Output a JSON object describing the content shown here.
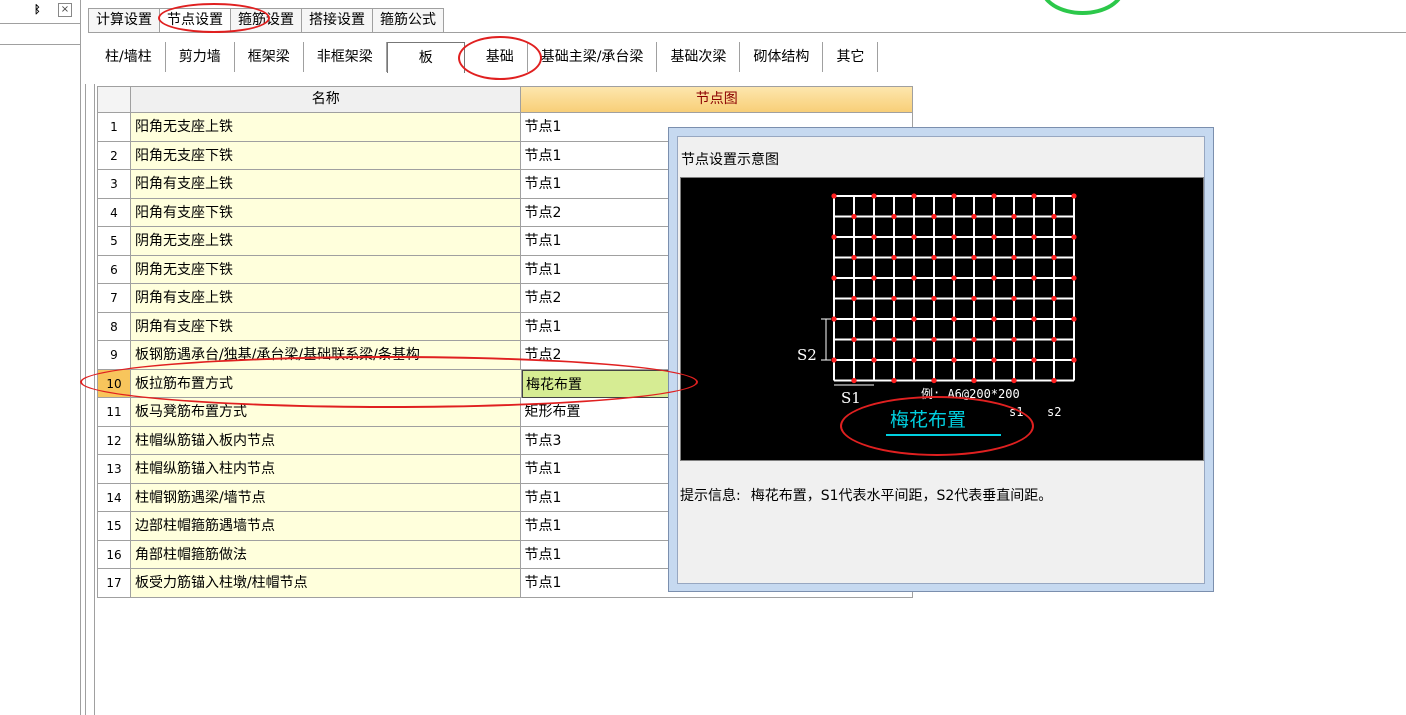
{
  "left_panel": {
    "pin": "📌",
    "close": "×"
  },
  "main_tabs": [
    "计算设置",
    "节点设置",
    "箍筋设置",
    "搭接设置",
    "箍筋公式"
  ],
  "main_tab_active": 1,
  "sub_tabs": [
    "柱/墙柱",
    "剪力墙",
    "框架梁",
    "非框架梁",
    "板",
    "基础",
    "基础主梁/承台梁",
    "基础次梁",
    "砌体结构",
    "其它"
  ],
  "sub_tab_active": 4,
  "grid": {
    "headers": {
      "name": "名称",
      "node": "节点图"
    },
    "rows": [
      {
        "num": "1",
        "name": "阳角无支座上铁",
        "node": "节点1"
      },
      {
        "num": "2",
        "name": "阳角无支座下铁",
        "node": "节点1"
      },
      {
        "num": "3",
        "name": "阳角有支座上铁",
        "node": "节点1"
      },
      {
        "num": "4",
        "name": "阳角有支座下铁",
        "node": "节点2"
      },
      {
        "num": "5",
        "name": "阴角无支座上铁",
        "node": "节点1"
      },
      {
        "num": "6",
        "name": "阴角无支座下铁",
        "node": "节点1"
      },
      {
        "num": "7",
        "name": "阴角有支座上铁",
        "node": "节点2"
      },
      {
        "num": "8",
        "name": "阴角有支座下铁",
        "node": "节点1"
      },
      {
        "num": "9",
        "name": "板钢筋遇承台/独基/承台梁/基础联系梁/条基构",
        "node": "节点2"
      },
      {
        "num": "10",
        "name": "板拉筋布置方式",
        "node": "梅花布置"
      },
      {
        "num": "11",
        "name": "板马凳筋布置方式",
        "node": "矩形布置"
      },
      {
        "num": "12",
        "name": "柱帽纵筋锚入板内节点",
        "node": "节点3"
      },
      {
        "num": "13",
        "name": "柱帽纵筋锚入柱内节点",
        "node": "节点1"
      },
      {
        "num": "14",
        "name": "柱帽钢筋遇梁/墙节点",
        "node": "节点1"
      },
      {
        "num": "15",
        "name": "边部柱帽箍筋遇墙节点",
        "node": "节点1"
      },
      {
        "num": "16",
        "name": "角部柱帽箍筋做法",
        "node": "节点1"
      },
      {
        "num": "17",
        "name": "板受力筋锚入柱墩/柱帽节点",
        "node": "节点1"
      }
    ],
    "selected_row": 9
  },
  "popup": {
    "title": "节点设置示意图",
    "diagram": {
      "s2_label": "S2",
      "s1_label": "S1",
      "example": "例: A6@200*200",
      "s1_small": "s1",
      "s2_small": "s2",
      "caption": "梅花布置"
    },
    "hint_label": "提示信息:",
    "hint_text": "梅花布置，S1代表水平间距，S2代表垂直间距。"
  },
  "colors": {
    "selected_row": "#d6ec93",
    "header_node": "#f8cf78",
    "name_cell": "#ffffdc",
    "annotation": "#e02020",
    "caption": "#00d0e0"
  }
}
